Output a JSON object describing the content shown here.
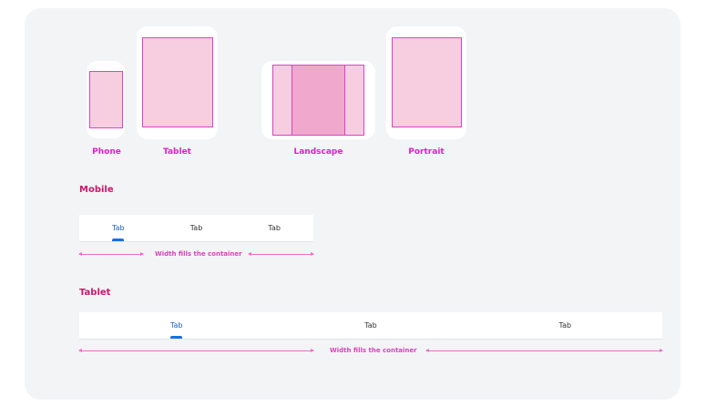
{
  "devices": {
    "phone_label": "Phone",
    "tablet_label": "Tablet",
    "landscape_label": "Landscape",
    "portrait_label": "Portrait"
  },
  "mobile": {
    "title": "Mobile",
    "tabs": [
      {
        "label": "Tab",
        "active": true
      },
      {
        "label": "Tab",
        "active": false
      },
      {
        "label": "Tab",
        "active": false
      }
    ],
    "measure_label": "Width fills the container"
  },
  "tablet": {
    "title": "Tablet",
    "tabs": [
      {
        "label": "Tab",
        "active": true
      },
      {
        "label": "Tab",
        "active": false
      },
      {
        "label": "Tab",
        "active": false
      }
    ],
    "measure_label": "Width fills the container"
  },
  "colors": {
    "accent_pink": "#e020c8",
    "title_pink": "#d0166a",
    "active_tab_blue": "#1a5fc4"
  }
}
